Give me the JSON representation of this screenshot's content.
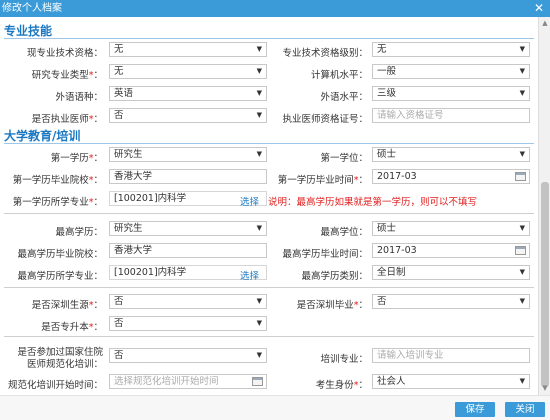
{
  "dialog": {
    "title": "修改个人档案",
    "close_icon": "close-icon"
  },
  "sections": {
    "professional": "专业技能",
    "education": "大学教育/培训"
  },
  "professional": {
    "tech_qualification": {
      "label": "现专业技术资格：",
      "value": "无"
    },
    "tech_level": {
      "label": "专业技术资格级别：",
      "value": "无"
    },
    "research_type": {
      "label": "研究专业类型",
      "value": "无"
    },
    "computer_level": {
      "label": "计算机水平：",
      "value": "一般"
    },
    "language": {
      "label": "外语语种：",
      "value": "英语"
    },
    "language_level": {
      "label": "外语水平：",
      "value": "三级"
    },
    "licensed_doctor": {
      "label": "是否执业医师",
      "value": "否"
    },
    "license_no": {
      "label": "执业医师资格证号：",
      "placeholder": "请输入资格证号"
    }
  },
  "education": {
    "first_degree_edu": {
      "label": "第一学历",
      "value": "研究生"
    },
    "first_degree": {
      "label": "第一学位：",
      "value": "硕士"
    },
    "first_school": {
      "label": "第一学历毕业院校",
      "value": "香港大学"
    },
    "first_grad_time": {
      "label": "第一学历毕业时间",
      "value": "2017-03"
    },
    "first_major": {
      "label": "第一学历所学专业",
      "value": "[100201]内科学",
      "select": "选择"
    },
    "first_note": "说明：最高学历如果就是第一学历，则可以不填写",
    "highest_edu": {
      "label": "最高学历：",
      "value": "研究生"
    },
    "highest_degree": {
      "label": "最高学位：",
      "value": "硕士"
    },
    "highest_school": {
      "label": "最高学历毕业院校：",
      "value": "香港大学"
    },
    "highest_grad_time": {
      "label": "最高学历毕业时间：",
      "value": "2017-03"
    },
    "highest_major": {
      "label": "最高学历所学专业：",
      "value": "[100201]内科学",
      "select": "选择"
    },
    "highest_type": {
      "label": "最高学历类别：",
      "value": "全日制"
    },
    "shenzhen_origin": {
      "label": "是否深圳生源",
      "value": "否"
    },
    "shenzhen_grad": {
      "label": "是否深圳毕业",
      "value": "否"
    },
    "upgrade": {
      "label": "是否专升本",
      "value": "否"
    },
    "national_training": {
      "label_line1": "是否参加过国家住院",
      "label_line2": "医师规范化培训：",
      "value": "否"
    },
    "training_major": {
      "label": "培训专业：",
      "placeholder": "请输入培训专业"
    },
    "training_start": {
      "label": "规范化培训开始时间：",
      "placeholder": "选择规范化培训开始时间"
    },
    "trainee_identity": {
      "label": "考生身份",
      "value": "社会人"
    }
  },
  "buttons": {
    "save": "保存",
    "close": "关闭"
  }
}
